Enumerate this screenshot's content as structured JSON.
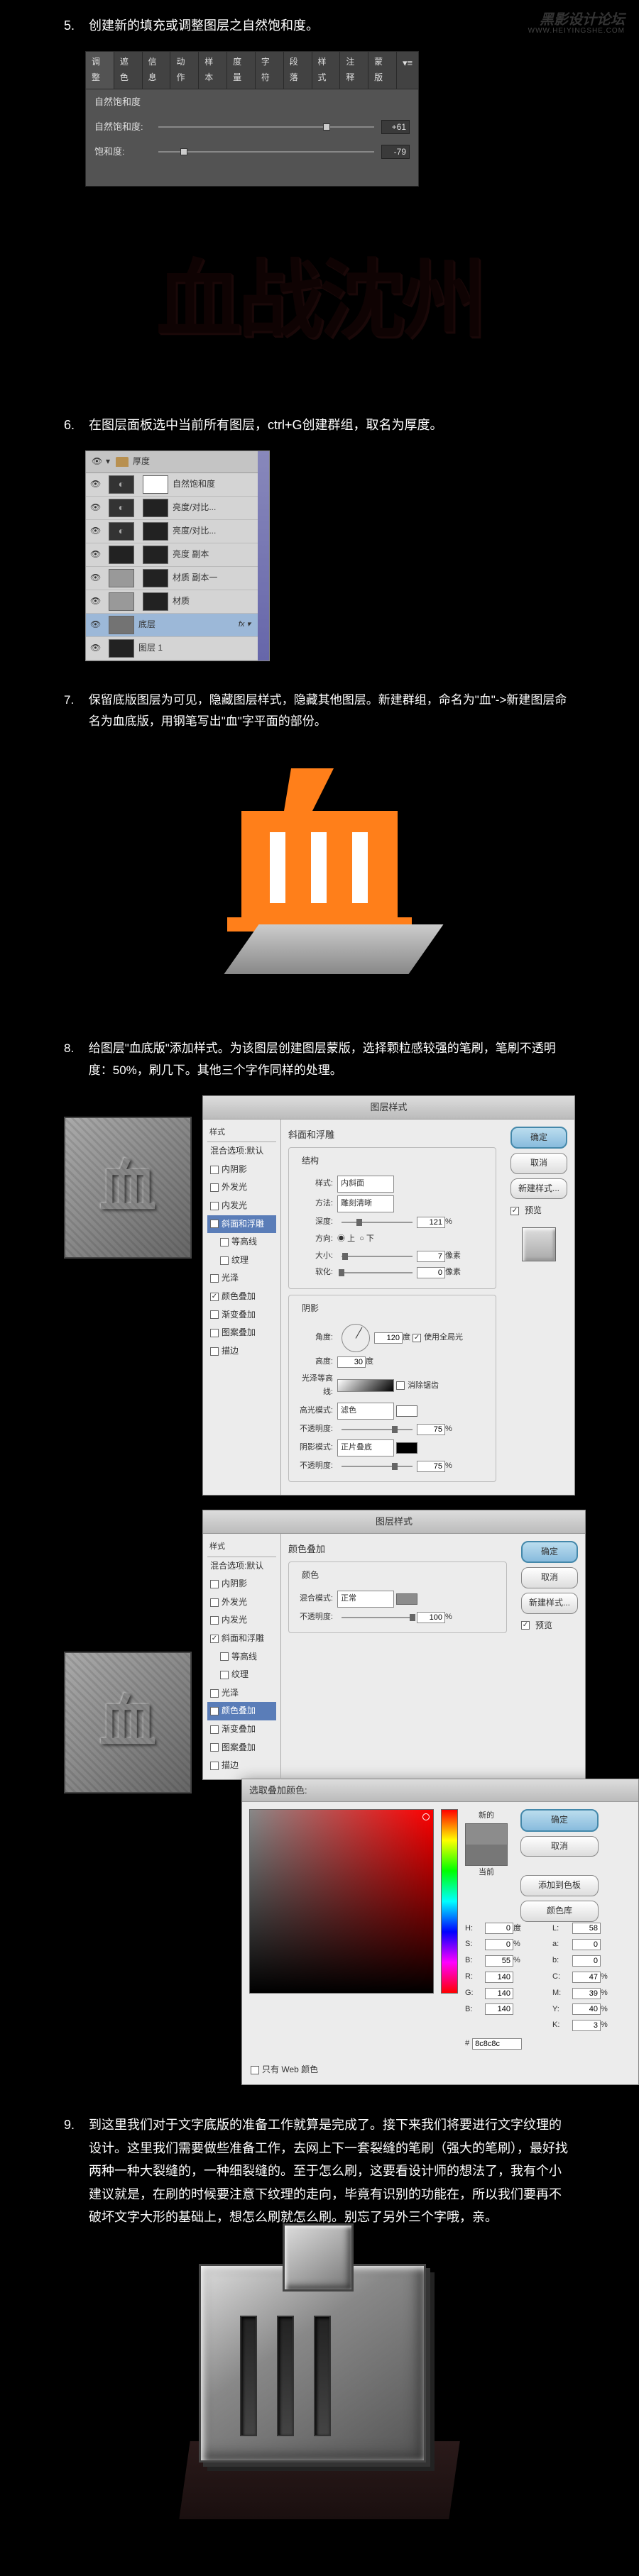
{
  "watermark": {
    "main": "黑影设计论坛",
    "sub": "WWW.HEIYINGSHE.COM"
  },
  "steps": {
    "s5": {
      "num": "5.",
      "text": "创建新的填充或调整图层之自然饱和度。"
    },
    "s6": {
      "num": "6.",
      "text": "在图层面板选中当前所有图层，ctrl+G创建群组，取名为厚度。"
    },
    "s7": {
      "num": "7.",
      "text": "保留底版图层为可见，隐藏图层样式，隐藏其他图层。新建群组，命名为\"血\"->新建图层命名为血底版，用钢笔写出\"血\"字平面的部份。"
    },
    "s8": {
      "num": "8.",
      "text": "给图层\"血底版\"添加样式。为该图层创建图层蒙版，选择颗粒感较强的笔刷，笔刷不透明度：50%，刷几下。其他三个字作同样的处理。"
    },
    "s9": {
      "num": "9.",
      "text": "到这里我们对于文字底版的准备工作就算是完成了。接下来我们将要进行文字纹理的设计。这里我们需要做些准备工作，去网上下一套裂缝的笔刷（强大的笔刷），最好找两种一种大裂缝的，一种细裂缝的。至于怎么刷，这要看设计师的想法了，我有个小建议就是，在刷的时候要注意下纹理的走向，毕竟有识别的功能在，所以我们要再不破坏文字大形的基础上，想怎么刷就怎么刷。别忘了另外三个字哦，亲。"
    }
  },
  "vibrance": {
    "tabs": [
      "调整",
      "遮色",
      "信息",
      "动作",
      "样本",
      "度量",
      "字符",
      "段落",
      "样式",
      "注释",
      "蒙版"
    ],
    "title": "自然饱和度",
    "row1": {
      "label": "自然饱和度:",
      "value": "+61"
    },
    "row2": {
      "label": "饱和度:",
      "value": "-79"
    }
  },
  "layers": {
    "group": "厚度",
    "items": [
      {
        "name": "自然饱和度",
        "adj": true
      },
      {
        "name": "亮度/对比...",
        "adj": true
      },
      {
        "name": "亮度/对比...",
        "adj": true
      },
      {
        "name": "亮度 副本",
        "thumb": "dark"
      },
      {
        "name": "材质 副本一",
        "thumb": "grey"
      },
      {
        "name": "材质",
        "thumb": "grey"
      },
      {
        "name": "底层",
        "thumb": "dark",
        "fx": "fx ▾"
      }
    ],
    "bg": "图层 1"
  },
  "dark_text": "血战沈州",
  "layerStyle": {
    "title": "图层样式",
    "sideHead": "样式",
    "blend": "混合选项:默认",
    "options": [
      "内阴影",
      "外发光",
      "内发光",
      "斜面和浮雕",
      "等高线",
      "纹理",
      "光泽",
      "颜色叠加",
      "渐变叠加",
      "图案叠加",
      "描边"
    ],
    "checked": [
      "斜面和浮雕",
      "颜色叠加"
    ],
    "active": "斜面和浮雕",
    "bevel": {
      "heading": "斜面和浮雕",
      "struct": "结构",
      "style_l": "样式:",
      "style_v": "内斜面",
      "tech_l": "方法:",
      "tech_v": "雕刻清晰",
      "depth_l": "深度:",
      "depth_v": "121",
      "pct": "%",
      "dir_l": "方向:",
      "up": "上",
      "down": "下",
      "size_l": "大小:",
      "size_v": "7",
      "px": "像素",
      "soft_l": "软化:",
      "soft_v": "0",
      "shade": "阴影",
      "angle_l": "角度:",
      "angle_v": "120",
      "deg": "度",
      "global": "使用全局光",
      "alt_l": "高度:",
      "alt_v": "30",
      "gloss_l": "光泽等高线:",
      "anti": "消除锯齿",
      "hmode_l": "高光模式:",
      "hmode_v": "滤色",
      "hop_l": "不透明度:",
      "hop_v": "75",
      "smode_l": "阴影模式:",
      "smode_v": "正片叠底",
      "sop_l": "不透明度:",
      "sop_v": "75"
    },
    "btns": {
      "ok": "确定",
      "cancel": "取消",
      "new": "新建样式...",
      "preview": "预览"
    }
  },
  "colorOverlay": {
    "heading": "颜色叠加",
    "sub": "颜色",
    "mode_l": "混合模式:",
    "mode_v": "正常",
    "op_l": "不透明度:",
    "op_v": "100"
  },
  "picker": {
    "title": "选取叠加颜色:",
    "new_l": "新的",
    "cur_l": "当前",
    "H_l": "H:",
    "H_v": "0",
    "H_u": "度",
    "S_l": "S:",
    "S_v": "0",
    "S_u": "%",
    "Bv_l": "B:",
    "Bv_v": "55",
    "Bv_u": "%",
    "R_l": "R:",
    "R_v": "140",
    "G_l": "G:",
    "G_v": "140",
    "B_l": "B:",
    "B_v": "140",
    "L_l": "L:",
    "L_v": "58",
    "a_l": "a:",
    "a_v": "0",
    "b_l": "b:",
    "b_v": "0",
    "C_l": "C:",
    "C_v": "47",
    "pct": "%",
    "M_l": "M:",
    "M_v": "39",
    "Y_l": "Y:",
    "Y_v": "40",
    "K_l": "K:",
    "K_v": "3",
    "hex_l": "#",
    "hex_v": "8c8c8c",
    "webonly": "只有 Web 颜色",
    "btns": {
      "ok": "确定",
      "cancel": "取消",
      "add": "添加到色板",
      "lib": "颜色库"
    }
  }
}
